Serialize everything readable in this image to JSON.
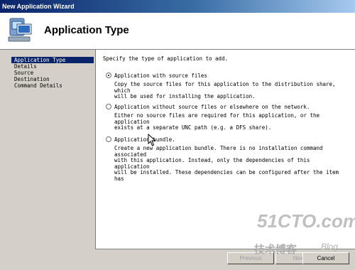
{
  "window": {
    "title": "New Application Wizard"
  },
  "header": {
    "title": "Application Type",
    "icon": "computer-icon"
  },
  "nav": {
    "items": [
      {
        "label": "Application Type",
        "selected": true
      },
      {
        "label": "Details"
      },
      {
        "label": "Source"
      },
      {
        "label": "Destination"
      },
      {
        "label": "Command Details"
      }
    ]
  },
  "content": {
    "prompt": "Specify the type of application to add.",
    "options": [
      {
        "label": "Application with source files",
        "desc_line1": "Copy the source files for this application to the distribution share, which",
        "desc_line2": "will be used for installing the application.",
        "checked": true
      },
      {
        "label": "Application without source files or elsewhere on the network.",
        "desc_line1": "Either no source files are required for this application, or the application",
        "desc_line2": "exists at a separate UNC path (e.g. a DFS share).",
        "checked": false
      },
      {
        "label": "Application bundle.",
        "desc_line1": "Create a new application bundle.  There is no installation command associated",
        "desc_line2": "with this application.  Instead, only the dependencies of this application",
        "desc_line3": "will be installed.  These dependencies can be configured after the item has",
        "checked": false
      }
    ]
  },
  "buttons": {
    "previous": "Previous",
    "next": "Next",
    "cancel": "Cancel"
  },
  "watermark": {
    "top": "51CTO.com",
    "bottom": "技术博客",
    "blog": "Blog"
  },
  "colors": {
    "selection": "#0a246a",
    "title_start": "#0a246a",
    "title_end": "#a6caf0",
    "face": "#d4d0c8"
  }
}
